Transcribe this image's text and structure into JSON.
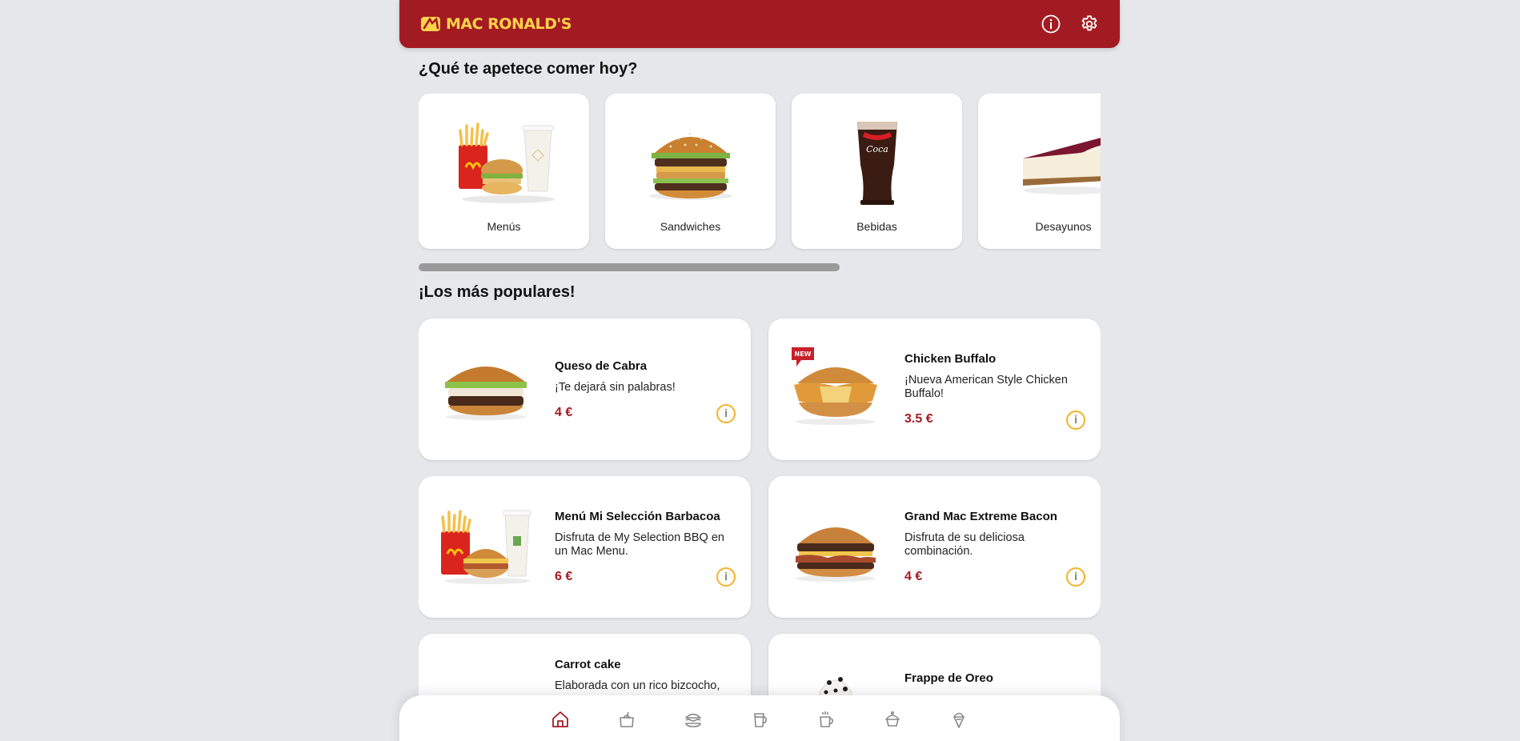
{
  "app": {
    "brand": "MAC RONALD'S",
    "brand_colors": {
      "primary": "#a31b22",
      "accent": "#ffd24a"
    },
    "header_icons": [
      "info-icon",
      "gear-icon"
    ]
  },
  "categories": {
    "title": "¿Qué te apetece comer hoy?",
    "items": [
      {
        "label": "Menús",
        "icon": "menu-combo-image"
      },
      {
        "label": "Sandwiches",
        "icon": "burger-image"
      },
      {
        "label": "Bebidas",
        "icon": "cola-glass-image"
      },
      {
        "label": "Desayunos",
        "icon": "cheesecake-image"
      }
    ]
  },
  "popular": {
    "title": "¡Los más populares!",
    "items": [
      {
        "name": "Queso de Cabra",
        "desc": "¡Te dejará sin palabras!",
        "price": "4 €",
        "badge": ""
      },
      {
        "name": "Chicken Buffalo",
        "desc": "¡Nueva American Style Chicken Buffalo!",
        "price": "3.5 €",
        "badge": "NEW"
      },
      {
        "name": "Menú Mi Selección Barbacoa",
        "desc": "Disfruta de My Selection BBQ en un Mac Menu.",
        "price": "6 €",
        "badge": ""
      },
      {
        "name": "Grand Mac Extreme Bacon",
        "desc": "Disfruta de su deliciosa combinación.",
        "price": "4 €",
        "badge": ""
      },
      {
        "name": "Carrot cake",
        "desc": "Elaborada con un rico bizcocho,",
        "price": "",
        "badge": ""
      },
      {
        "name": "Frappe de Oreo",
        "desc": "",
        "price": "",
        "badge": ""
      }
    ],
    "info_label": "i"
  },
  "bottom_nav": {
    "items": [
      "home-icon",
      "kids-meal-icon",
      "burger-icon",
      "drink-icon",
      "coffee-icon",
      "dessert-icon",
      "ice-cream-icon"
    ],
    "active": "home-icon"
  }
}
